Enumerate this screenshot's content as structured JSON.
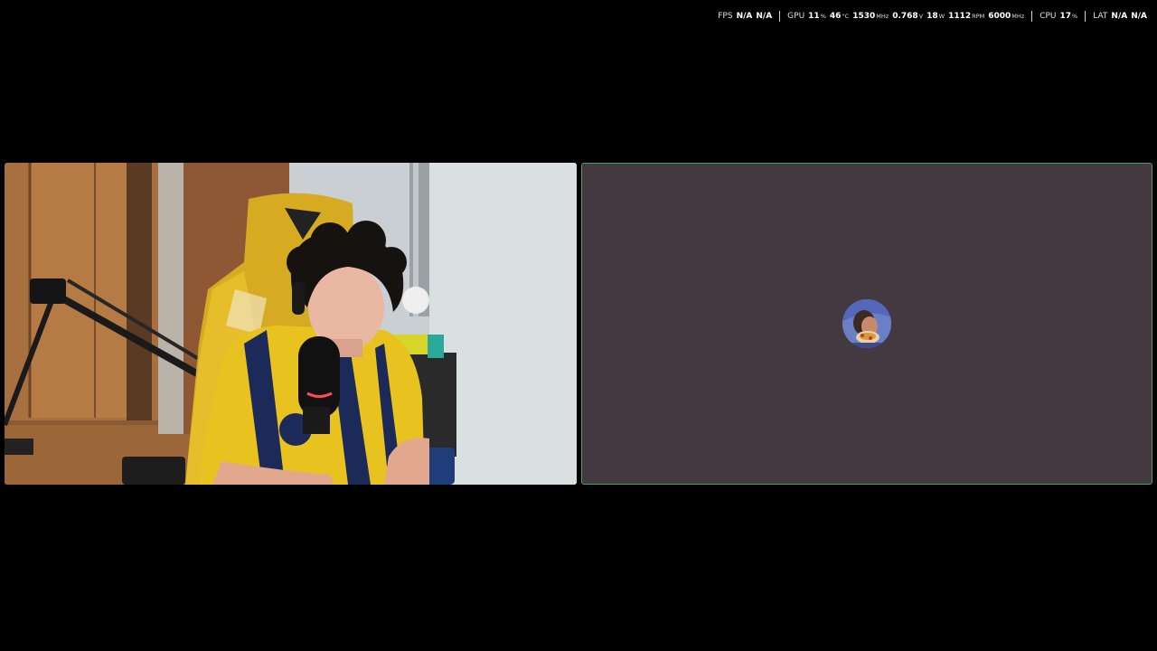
{
  "overlay": {
    "fps": {
      "label": "FPS",
      "value1": "N/A",
      "value2": "N/A"
    },
    "gpu": {
      "label": "GPU",
      "usage": "11",
      "usage_unit": "%",
      "temp": "46",
      "temp_unit": "°C",
      "clock": "1530",
      "clock_unit": "MHz",
      "voltage": "0.768",
      "voltage_unit": "V",
      "power": "18",
      "power_unit": "W",
      "fan": "1112",
      "fan_unit": "RPM",
      "mem_clock": "6000",
      "mem_clock_unit": "MHz"
    },
    "cpu": {
      "label": "CPU",
      "usage": "17",
      "usage_unit": "%"
    },
    "lat": {
      "label": "LAT",
      "value1": "N/A",
      "value2": "N/A"
    }
  },
  "tiles": {
    "camera": {
      "speaking": false
    },
    "avatar_tile": {
      "speaking": true,
      "speaking_color": "#3ba55c",
      "background": "#453941"
    }
  }
}
